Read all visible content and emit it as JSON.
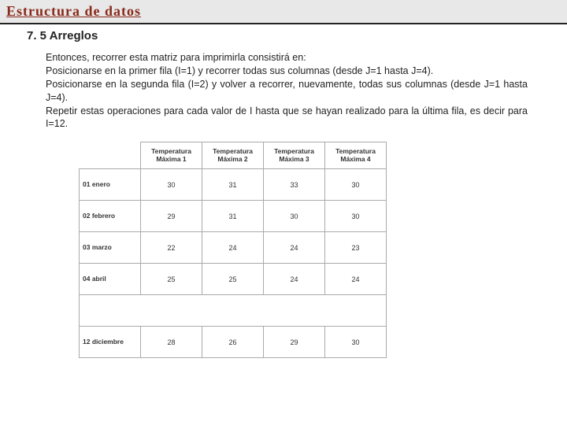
{
  "header": {
    "title": "Estructura de datos",
    "subtitle": "7. 5 Arreglos"
  },
  "paragraph": {
    "line1": "Entonces, recorrer esta matriz para imprimirla consistirá en:",
    "line2": "Posicionarse en la primer fila (I=1) y recorrer todas sus columnas (desde J=1 hasta J=4).",
    "line3": "Posicionarse en la segunda fila (I=2) y volver a recorrer, nuevamente, todas sus columnas (desde J=1 hasta J=4).",
    "line4": "Repetir estas operaciones para cada valor de I hasta que se hayan realizado para la última fila, es decir para I=12."
  },
  "table": {
    "col_headers": [
      "Temperatura Máxima 1",
      "Temperatura Máxima 2",
      "Temperatura Máxima 3",
      "Temperatura Máxima 4"
    ],
    "rows": [
      {
        "label": "01 enero",
        "values": [
          "30",
          "31",
          "33",
          "30"
        ]
      },
      {
        "label": "02 febrero",
        "values": [
          "29",
          "31",
          "30",
          "30"
        ]
      },
      {
        "label": "03 marzo",
        "values": [
          "22",
          "24",
          "24",
          "23"
        ]
      },
      {
        "label": "04 abril",
        "values": [
          "25",
          "25",
          "24",
          "24"
        ]
      }
    ],
    "last_row": {
      "label": "12 diciembre",
      "values": [
        "28",
        "26",
        "29",
        "30"
      ]
    }
  }
}
